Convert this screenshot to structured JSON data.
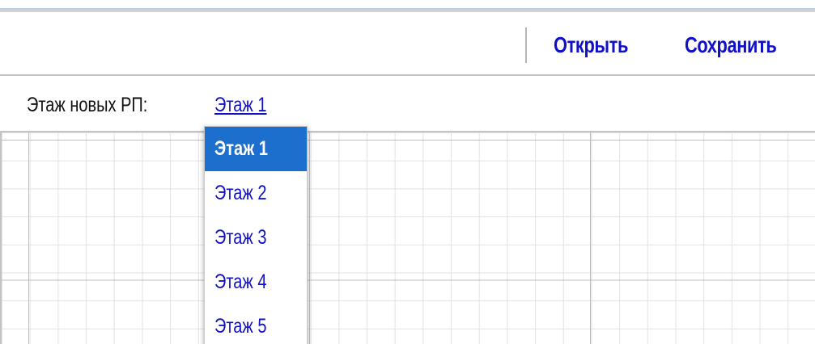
{
  "toolbar": {
    "open_label": "Открыть",
    "save_label": "Сохранить"
  },
  "floor_selector": {
    "label": "Этаж новых РП:",
    "current_value": "Этаж 1",
    "options": [
      "Этаж 1",
      "Этаж 2",
      "Этаж 3",
      "Этаж 4",
      "Этаж 5"
    ],
    "selected_index": 0
  },
  "colors": {
    "link": "#1010c8",
    "selected_bg": "#1c6fcc",
    "grid_line": "#e2e2e2",
    "border": "#c4c4c4"
  }
}
